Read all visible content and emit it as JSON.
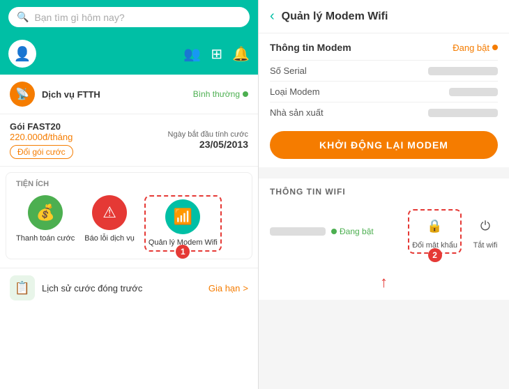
{
  "left": {
    "search": {
      "placeholder": "Bạn tìm gì hôm nay?"
    },
    "service": {
      "name": "Dịch vụ FTTH",
      "status": "Bình thường"
    },
    "plan": {
      "name": "Gói FAST20",
      "price": "220.000đ/tháng",
      "change_btn": "Đổi gói cước",
      "date_label": "Ngày bắt đầu tính cước",
      "date": "23/05/2013"
    },
    "tien_ich": {
      "title": "TIỆN ÍCH",
      "items": [
        {
          "label": "Thanh toán cước"
        },
        {
          "label": "Báo lỗi dịch vụ"
        },
        {
          "label": "Quản lý Modem Wifi"
        }
      ]
    },
    "history": {
      "label": "Lịch sử cước đóng trước",
      "action": "Gia hạn",
      "arrow": ">"
    }
  },
  "right": {
    "header": {
      "back": "‹",
      "title": "Quản lý Modem Wifi"
    },
    "modem_info": {
      "title": "Thông tin Modem",
      "status": "Đang bật",
      "fields": [
        {
          "label": "Số Serial"
        },
        {
          "label": "Loại Modem"
        },
        {
          "label": "Nhà sản xuất"
        }
      ],
      "restart_btn": "KHỞI ĐỘNG LẠI MODEM"
    },
    "wifi_info": {
      "title": "THÔNG TIN WIFI",
      "status": "Đang bật",
      "actions": [
        {
          "label": "Đổi mật khẩu"
        },
        {
          "label": "Tắt wifi"
        }
      ]
    },
    "badge1": "1",
    "badge2": "2"
  }
}
